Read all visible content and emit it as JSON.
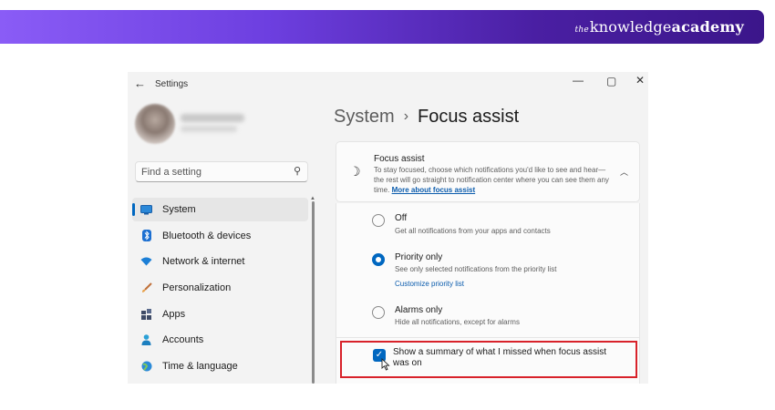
{
  "banner": {
    "brand_the": "the",
    "brand_knowledge": "knowledge",
    "brand_academy": "academy",
    "gradient_start": "#8a5cf6",
    "gradient_end": "#3b168a"
  },
  "window": {
    "title": "Settings",
    "back_icon": "arrow-left-icon",
    "minimize_glyph": "—",
    "maximize_glyph": "▢",
    "close_glyph": "✕"
  },
  "search": {
    "placeholder": "Find a setting",
    "icon": "search-icon"
  },
  "sidebar": {
    "items": [
      {
        "label": "System",
        "icon": "monitor-icon",
        "active": true
      },
      {
        "label": "Bluetooth & devices",
        "icon": "bluetooth-icon",
        "active": false
      },
      {
        "label": "Network & internet",
        "icon": "wifi-icon",
        "active": false
      },
      {
        "label": "Personalization",
        "icon": "brush-icon",
        "active": false
      },
      {
        "label": "Apps",
        "icon": "apps-icon",
        "active": false
      },
      {
        "label": "Accounts",
        "icon": "person-icon",
        "active": false
      },
      {
        "label": "Time & language",
        "icon": "globe-icon",
        "active": false
      }
    ]
  },
  "breadcrumb": {
    "parent": "System",
    "separator": "›",
    "current": "Focus assist"
  },
  "focus_card": {
    "title": "Focus assist",
    "description": "To stay focused, choose which notifications you'd like to see and hear—the rest will go straight to notification center where you can see them any time.",
    "link": "More about focus assist",
    "icon": "moon-icon",
    "chevron": "chevron-up-icon"
  },
  "options": [
    {
      "title": "Off",
      "desc": "Get all notifications from your apps and contacts",
      "checked": false
    },
    {
      "title": "Priority only",
      "desc": "See only selected notifications from the priority list",
      "link": "Customize priority list",
      "checked": true
    },
    {
      "title": "Alarms only",
      "desc": "Hide all notifications, except for alarms",
      "checked": false
    }
  ],
  "summary": {
    "label": "Show a summary of what I missed when focus assist was on",
    "checked": true
  },
  "colors": {
    "accent": "#0067c0",
    "highlight_border": "#d8222a",
    "link": "#0b5cad"
  }
}
